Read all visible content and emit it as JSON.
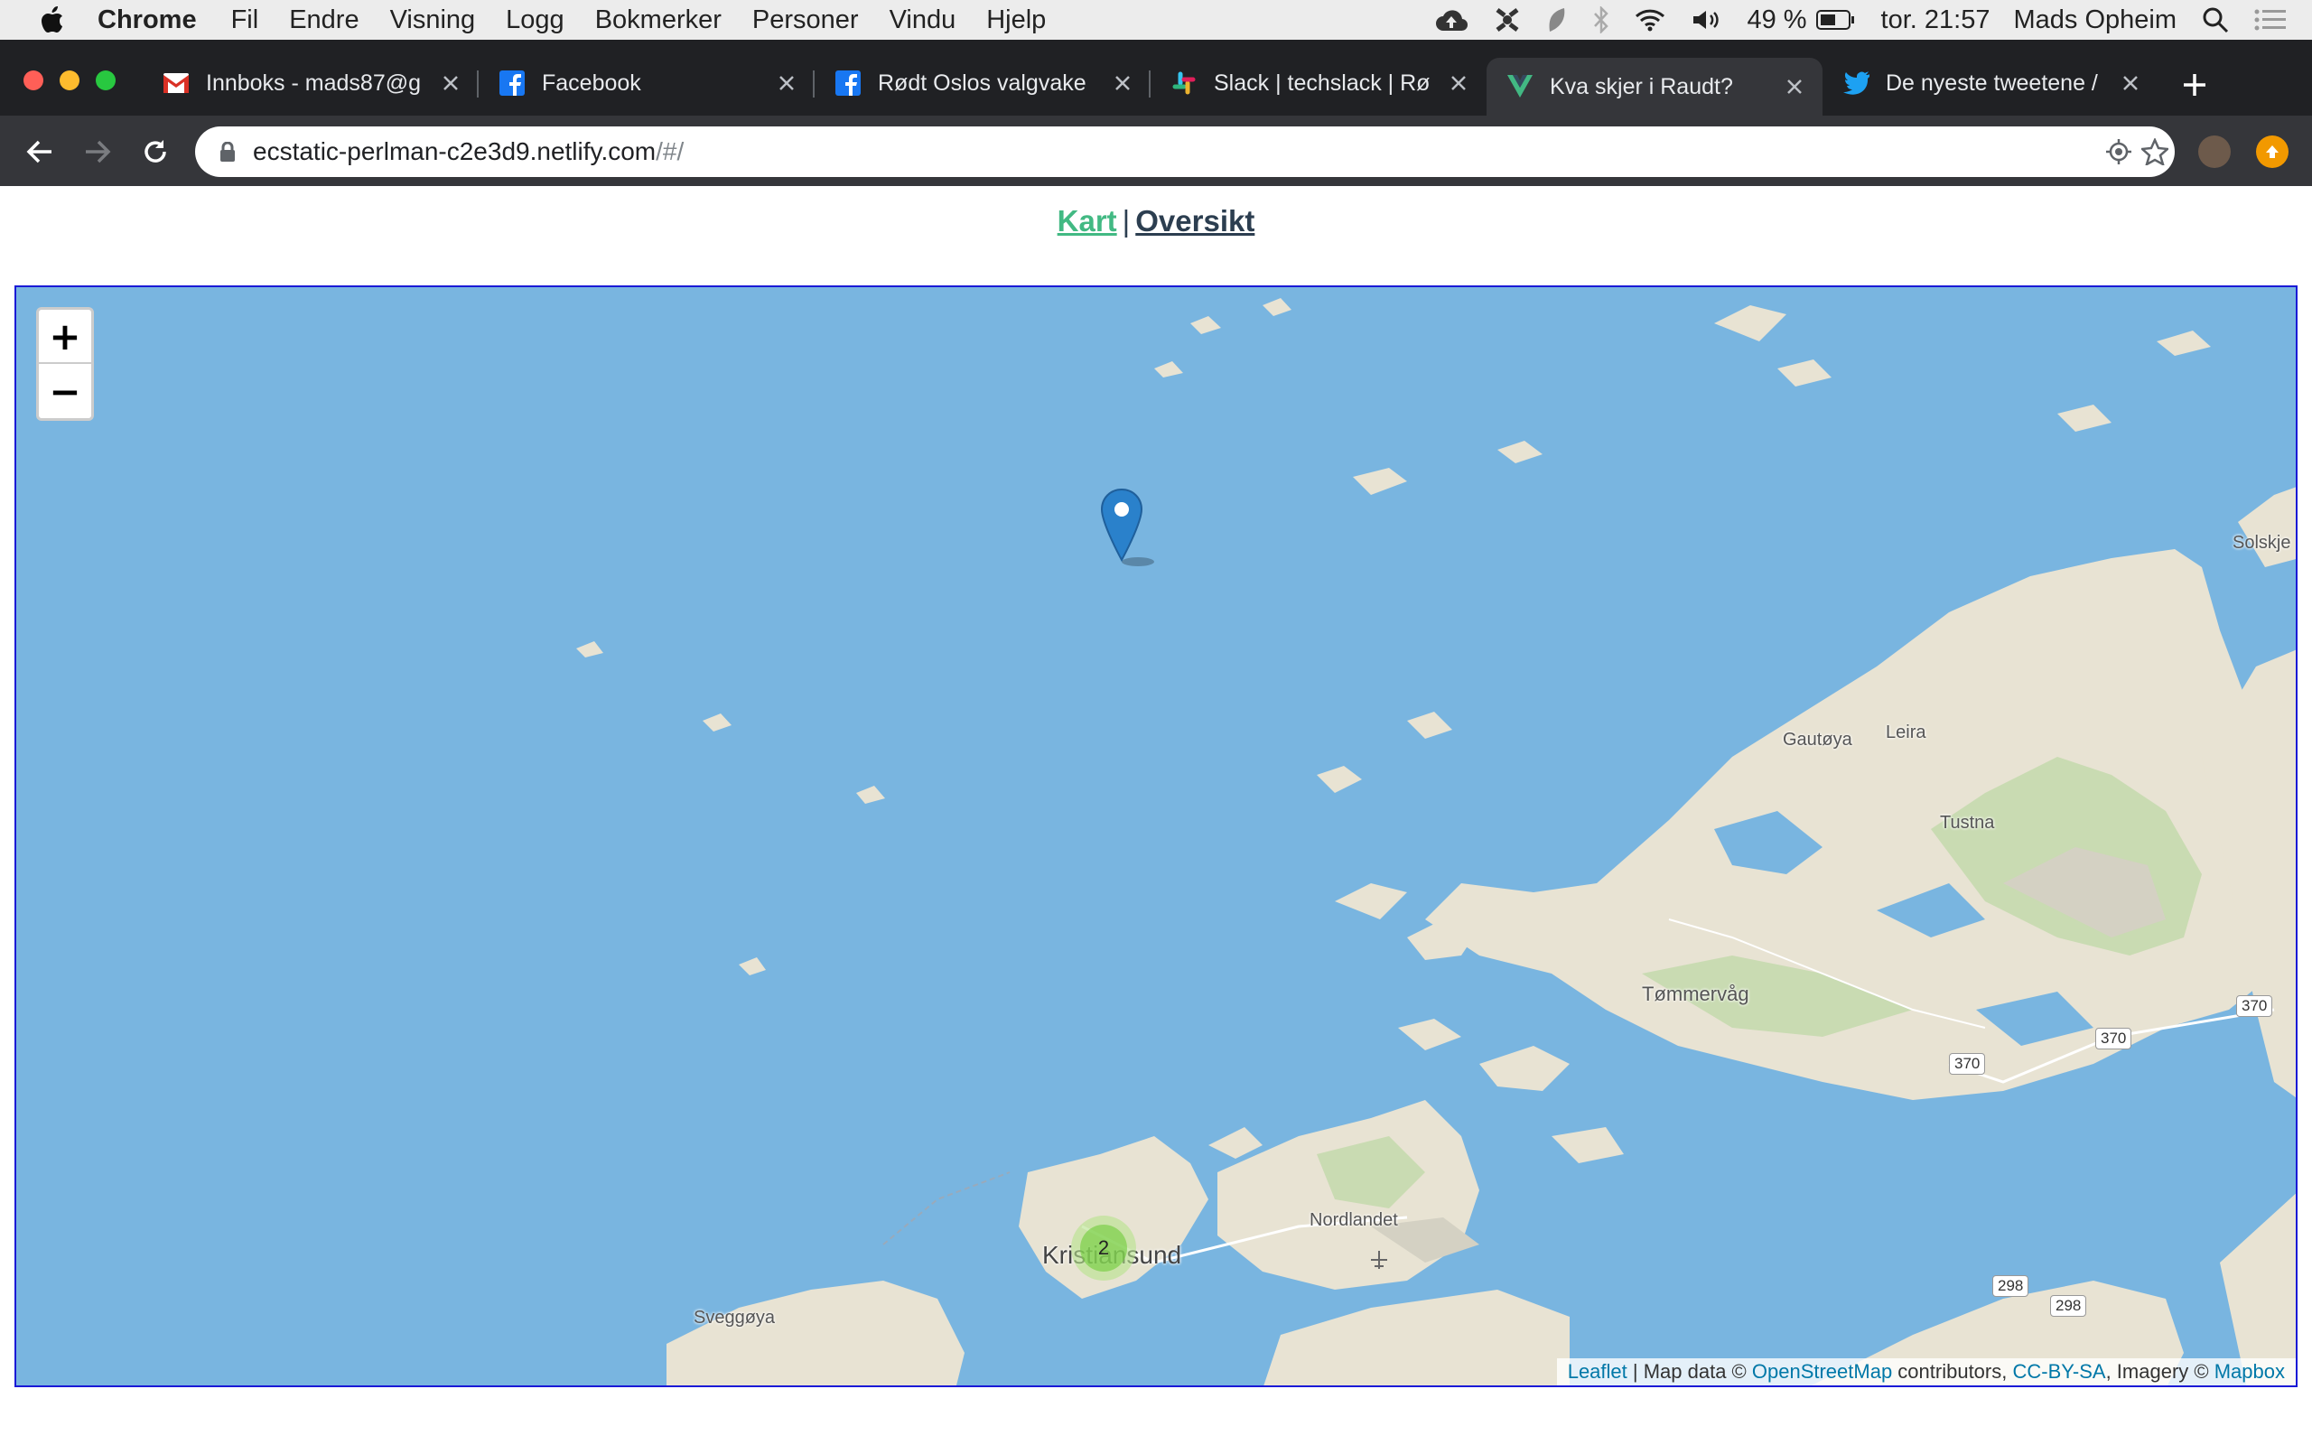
{
  "menubar": {
    "app": "Chrome",
    "items": [
      "Fil",
      "Endre",
      "Visning",
      "Logg",
      "Bokmerker",
      "Personer",
      "Vindu",
      "Hjelp"
    ],
    "battery": "49 %",
    "clock": "tor. 21:57",
    "user": "Mads Opheim"
  },
  "tabs": [
    {
      "title": "Innboks - mads87@g",
      "icon": "gmail-icon"
    },
    {
      "title": "Facebook",
      "icon": "facebook-icon"
    },
    {
      "title": "Rødt Oslos valgvake",
      "icon": "facebook-icon"
    },
    {
      "title": "Slack | techslack | Rø",
      "icon": "slack-icon"
    },
    {
      "title": "Kva skjer i Raudt?",
      "icon": "vue-icon",
      "active": true
    },
    {
      "title": "De nyeste tweetene /",
      "icon": "twitter-icon"
    }
  ],
  "omnibox": {
    "host": "ecstatic-perlman-c2e3d9.netlify.com",
    "path": "/#/"
  },
  "page": {
    "nav_kart": "Kart",
    "nav_separator": "|",
    "nav_oversikt": "Oversikt"
  },
  "map": {
    "zoom_in": "+",
    "zoom_out": "−",
    "cluster_count": "2",
    "labels": {
      "solskjel": "Solskje",
      "gautoya": "Gautøya",
      "leira": "Leira",
      "tustna": "Tustna",
      "tommervag": "Tømmervåg",
      "nordlandet": "Nordlandet",
      "kristiansund": "Kristiansund",
      "sveggoya": "Sveggøya"
    },
    "road_shields": [
      "370",
      "370",
      "370",
      "298",
      "298"
    ],
    "attribution": {
      "leaflet": "Leaflet",
      "text1": " | Map data © ",
      "osm": "OpenStreetMap",
      "text2": " contributors, ",
      "ccbysa": "CC-BY-SA",
      "text3": ", Imagery © ",
      "mapbox": "Mapbox"
    },
    "colors": {
      "water": "#79b5e0",
      "land": "#e8e3d3",
      "forest": "#c9dbb2"
    }
  }
}
